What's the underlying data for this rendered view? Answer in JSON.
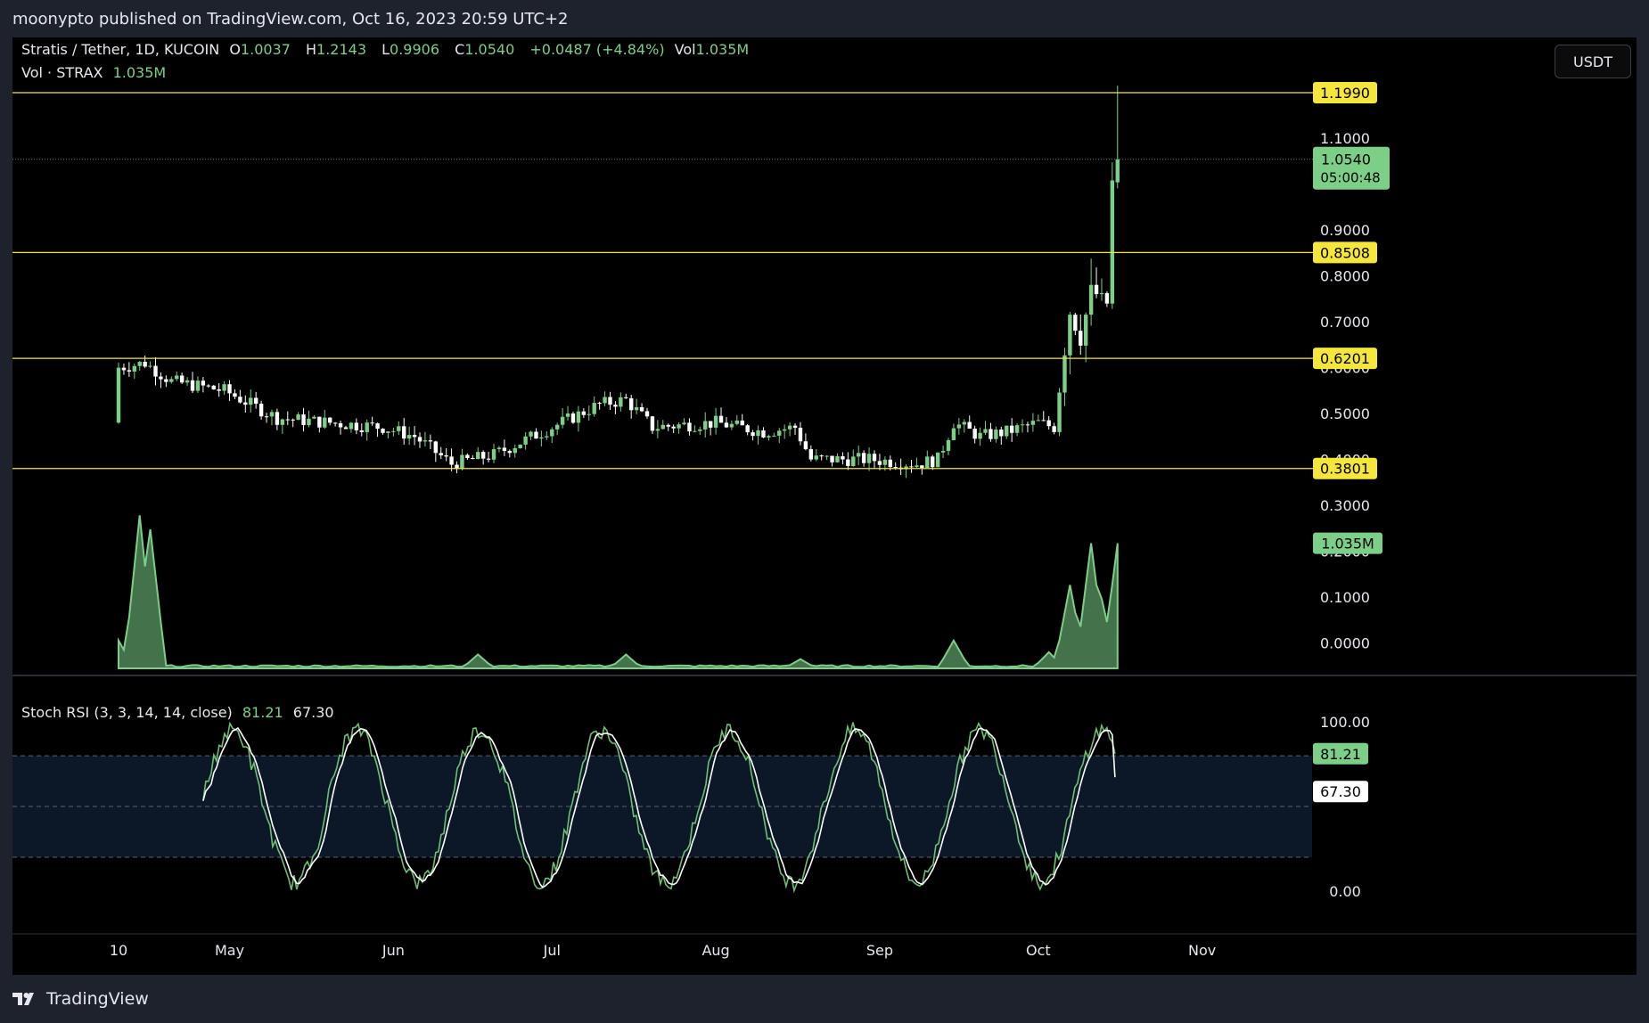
{
  "header": {
    "published": "moonypto published on TradingView.com, Oct 16, 2023 20:59 UTC+2"
  },
  "legend": {
    "symbol": "Stratis / Tether, 1D, KUCOIN",
    "o_label": "O",
    "o": "1.0037",
    "h_label": "H",
    "h": "1.2143",
    "l_label": "L",
    "l": "0.9906",
    "c_label": "C",
    "c": "1.0540",
    "change": "+0.0487 (+4.84%)",
    "vol_label": "Vol",
    "vol": "1.035M",
    "vol_series": "Vol · STRAX",
    "vol_series_value": "1.035M"
  },
  "currency_button": "USDT",
  "stoch": {
    "label": "Stoch RSI (3, 3, 14, 14, close)",
    "k": "81.21",
    "d": "67.30"
  },
  "footer": {
    "brand": "TradingView"
  },
  "colors": {
    "up": "#7ccf87",
    "down": "#ffffff",
    "level": "#f5e63b",
    "volume": "#7ccf87",
    "k": "#6fbf73",
    "d": "#ffffff"
  },
  "chart_data": {
    "type": "candlestick",
    "x_ticks": [
      "10",
      "May",
      "Jun",
      "Jul",
      "Aug",
      "Sep",
      "Oct",
      "Nov"
    ],
    "y_ticks": [
      "1.1000",
      "1.0000",
      "0.9000",
      "0.8000",
      "0.7000",
      "0.6000",
      "0.5000",
      "0.4000",
      "0.3000",
      "0.2000",
      "0.1000",
      "0.0000"
    ],
    "ylim": [
      0.0,
      1.25
    ],
    "horizontal_levels": [
      "1.1990",
      "0.8508",
      "0.6201",
      "0.3801"
    ],
    "last_price": "1.0540",
    "countdown": "05:00:48",
    "volume_last": "1.035M",
    "anchors": [
      {
        "date": "Apr 10",
        "close": 0.6
      },
      {
        "date": "Apr 15",
        "close": 0.61
      },
      {
        "date": "Apr 20",
        "close": 0.57
      },
      {
        "date": "Apr 25",
        "close": 0.56
      },
      {
        "date": "Apr 30",
        "close": 0.55
      },
      {
        "date": "May 5",
        "close": 0.52
      },
      {
        "date": "May 10",
        "close": 0.49
      },
      {
        "date": "May 20",
        "close": 0.48
      },
      {
        "date": "May 30",
        "close": 0.47
      },
      {
        "date": "Jun 5",
        "close": 0.45
      },
      {
        "date": "Jun 12",
        "close": 0.39
      },
      {
        "date": "Jun 20",
        "close": 0.41
      },
      {
        "date": "Jul 1",
        "close": 0.47
      },
      {
        "date": "Jul 10",
        "close": 0.52
      },
      {
        "date": "Jul 15",
        "close": 0.53
      },
      {
        "date": "Jul 20",
        "close": 0.47
      },
      {
        "date": "Aug 1",
        "close": 0.48
      },
      {
        "date": "Aug 10",
        "close": 0.46
      },
      {
        "date": "Aug 16",
        "close": 0.47
      },
      {
        "date": "Aug 19",
        "close": 0.4
      },
      {
        "date": "Aug 30",
        "close": 0.4
      },
      {
        "date": "Sep 8",
        "close": 0.39
      },
      {
        "date": "Sep 12",
        "close": 0.4
      },
      {
        "date": "Sep 15",
        "close": 0.48
      },
      {
        "date": "Sep 20",
        "close": 0.45
      },
      {
        "date": "Sep 25",
        "close": 0.46
      },
      {
        "date": "Oct 1",
        "close": 0.48
      },
      {
        "date": "Oct 4",
        "close": 0.47
      },
      {
        "date": "Oct 7",
        "close": 0.72
      },
      {
        "date": "Oct 9",
        "close": 0.66
      },
      {
        "date": "Oct 11",
        "close": 0.77
      },
      {
        "date": "Oct 14",
        "close": 0.74
      },
      {
        "date": "Oct 15",
        "close": 1.0037
      },
      {
        "date": "Oct 16",
        "open": 1.0037,
        "high": 1.2143,
        "low": 0.9906,
        "close": 1.054
      }
    ],
    "volume_peaks": [
      {
        "date": "Apr 10",
        "value": 0.06
      },
      {
        "date": "Apr 14",
        "value": 0.33
      },
      {
        "date": "Apr 16",
        "value": 0.3
      },
      {
        "date": "Jun 17",
        "value": 0.03
      },
      {
        "date": "Jul 15",
        "value": 0.03
      },
      {
        "date": "Aug 17",
        "value": 0.02
      },
      {
        "date": "Sep 15",
        "value": 0.06
      },
      {
        "date": "Oct 3",
        "value": 0.035
      },
      {
        "date": "Oct 7",
        "value": 0.18
      },
      {
        "date": "Oct 11",
        "value": 0.27
      },
      {
        "date": "Oct 13",
        "value": 0.15
      },
      {
        "date": "Oct 16",
        "value": 0.27
      }
    ],
    "stoch_ticks": [
      "100.00",
      "0.00"
    ],
    "stoch_band": [
      20,
      80
    ],
    "stoch_k_last": 81.21,
    "stoch_d_last": 67.3
  }
}
